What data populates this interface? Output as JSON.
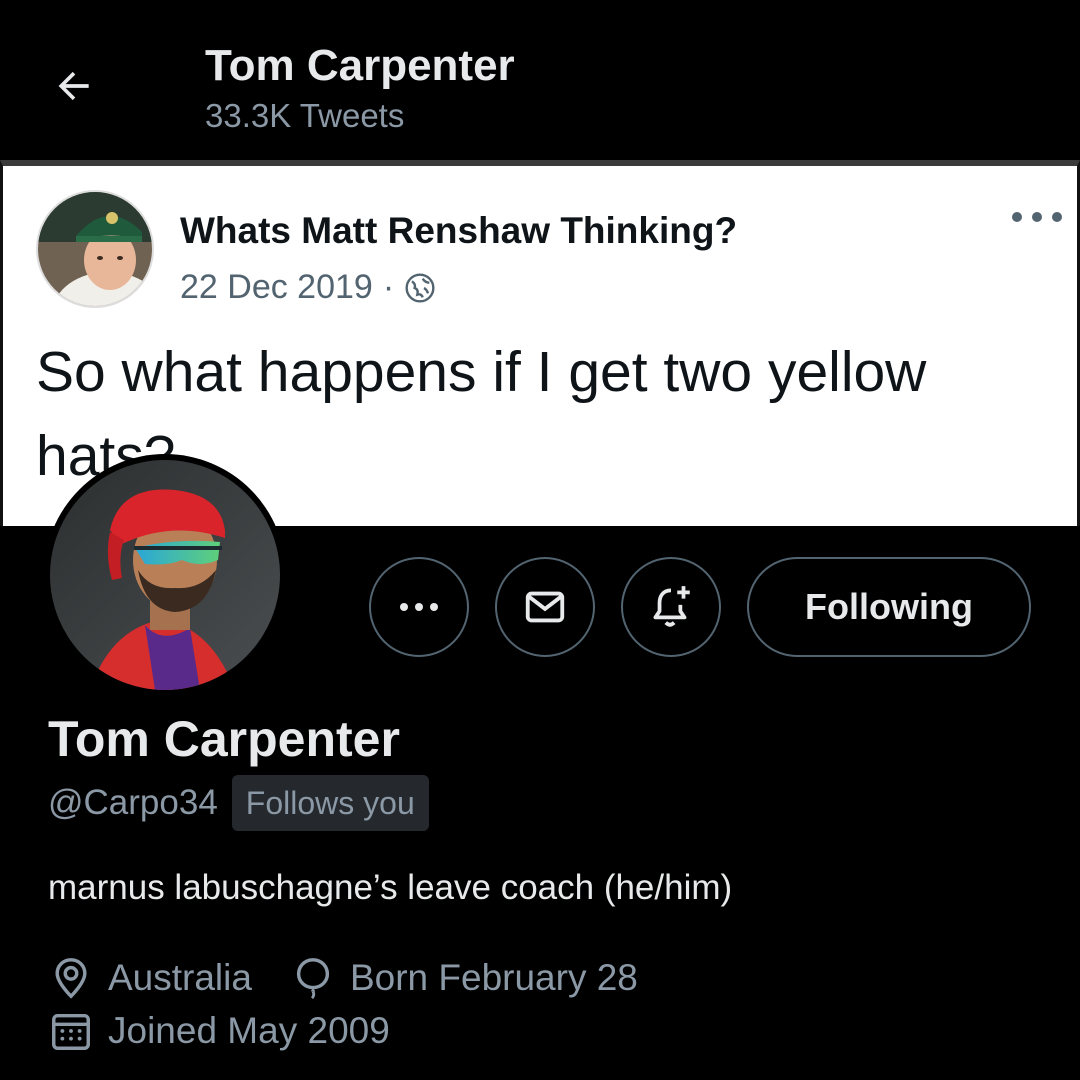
{
  "header": {
    "title": "Tom Carpenter",
    "subtitle": "33.3K Tweets"
  },
  "banner": {
    "quoted_name": "Whats Matt Renshaw Thinking?",
    "quoted_date": "22 Dec 2019",
    "date_separator": "·",
    "quoted_text": "So what happens if I get two yellow hats?"
  },
  "actions": {
    "following_label": "Following"
  },
  "profile": {
    "display_name": "Tom Carpenter",
    "handle": "@Carpo34",
    "follows_badge": "Follows you",
    "bio": "marnus labuschagne’s leave coach (he/him)",
    "location": "Australia",
    "birthday": "Born February 28",
    "joined": "Joined May 2009"
  },
  "icons": {
    "back": "arrow-left-icon",
    "more": "more-horizontal-icon",
    "mail": "envelope-icon",
    "bell": "bell-plus-icon",
    "location": "location-pin-icon",
    "birthday": "balloon-icon",
    "joined": "calendar-icon",
    "globe": "globe-icon"
  },
  "colors": {
    "background": "#000000",
    "text_primary": "#e7e9ea",
    "text_secondary": "#8b98a5",
    "border": "#536471",
    "badge_bg": "#25292e"
  }
}
